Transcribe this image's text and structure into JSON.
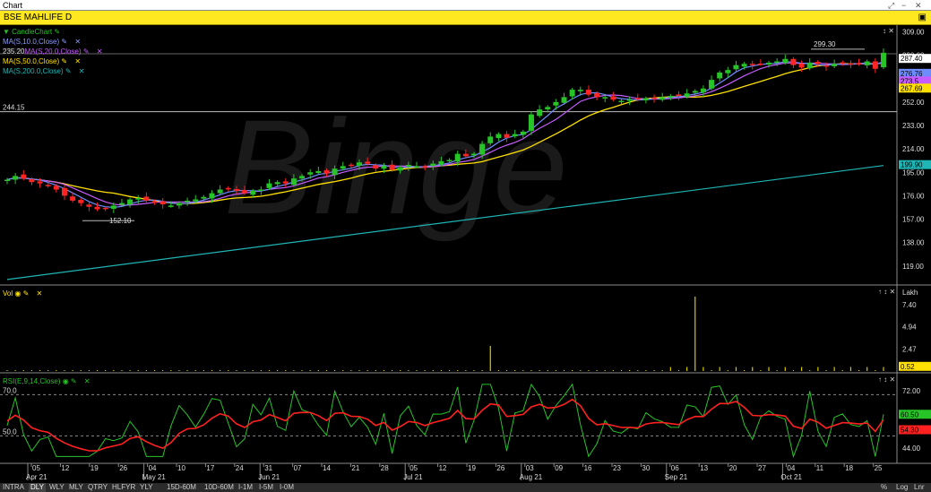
{
  "window": {
    "title": "Chart"
  },
  "symbol": {
    "label": "BSE MAHLIFE D"
  },
  "overlays": [
    {
      "label": "CandleChart",
      "color": "#27c427"
    },
    {
      "label": "MA(S,10.0,Close)",
      "color": "#6f8cff"
    },
    {
      "label": "MA(S,20.0,Close)",
      "color": "#c65cff",
      "prefix": "235.20"
    },
    {
      "label": "MA(S,50.0,Close)",
      "color": "#ffe000"
    },
    {
      "label": "MA(S,200.0,Close)",
      "color": "#1fb5b5"
    }
  ],
  "panels": {
    "vol": {
      "label": "Vol",
      "unit": "Lakh"
    },
    "rsi": {
      "label": "RSI(E,9,14,Close)"
    }
  },
  "bottom": {
    "intervals": [
      "INTRA",
      "DLY",
      "WLY",
      "MLY",
      "QTRY",
      "HLFYR",
      "YLY",
      "15D-60M",
      "10D-60M",
      "I-1M",
      "I-5M",
      "I-0M"
    ],
    "selected": "DLY",
    "right": [
      "%",
      "Log",
      "Lnr"
    ]
  },
  "chart_data": [
    {
      "type": "candlestick",
      "x_axis": {
        "ticks": [
          "05",
          "12",
          "19",
          "26",
          "04",
          "10",
          "17",
          "24",
          "31",
          "07",
          "14",
          "21",
          "28",
          "05",
          "12",
          "19",
          "26",
          "03",
          "09",
          "16",
          "23",
          "30",
          "06",
          "13",
          "20",
          "27",
          "04",
          "11",
          "18",
          "25"
        ],
        "months": [
          "Apr 21",
          "May 21",
          "Jun 21",
          "Jul 21",
          "Aug 21",
          "Sep 21",
          "Oct 21"
        ]
      },
      "y_ticks": [
        309.0,
        290.0,
        271.0,
        252.0,
        233.0,
        214.0,
        195.0,
        176.0,
        157.0,
        138.0,
        119.0
      ],
      "ylim": [
        105,
        313
      ],
      "grid": false,
      "close": [
        189,
        192,
        190,
        187,
        186,
        184,
        181,
        176,
        172,
        170,
        167,
        165,
        166,
        168,
        170,
        173,
        174,
        172,
        171,
        169,
        168,
        170,
        172,
        173,
        175,
        178,
        181,
        182,
        180,
        178,
        180,
        181,
        186,
        187,
        186,
        190,
        192,
        195,
        196,
        194,
        198,
        200,
        201,
        203,
        202,
        198,
        200,
        197,
        199,
        201,
        200,
        199,
        202,
        204,
        205,
        210,
        208,
        210,
        218,
        224,
        226,
        223,
        226,
        228,
        242,
        246,
        248,
        252,
        256,
        262,
        262,
        258,
        256,
        256,
        254,
        253,
        254,
        254,
        255,
        255,
        256,
        257,
        257,
        259,
        261,
        263,
        270,
        276,
        278,
        282,
        283,
        282,
        283,
        284,
        285,
        287,
        282,
        280,
        284,
        283,
        281,
        283,
        284,
        283,
        283,
        285,
        279,
        292
      ],
      "annotations": [
        {
          "text": "299.30",
          "value": 299.3
        },
        {
          "text": "244.15",
          "value": 244.15
        },
        {
          "text": "152.10",
          "value": 152.1
        }
      ],
      "series": [
        {
          "name": "MA(S,10.0,Close)",
          "last": 276.76,
          "last_label": "276.76"
        },
        {
          "name": "MA(S,20.0,Close)",
          "last": 273.5,
          "last_label": "273.5"
        },
        {
          "name": "MA(S,50.0,Close)",
          "last": 267.69,
          "last_label": "267.69"
        },
        {
          "name": "MA(S,200.0,Close)",
          "start": 108,
          "end": 200.5,
          "last_label": "199.90"
        }
      ],
      "last_price": {
        "value": 287.4,
        "label": "287.40"
      }
    },
    {
      "type": "bar",
      "title": "Vol",
      "unit": "Lakh",
      "y_ticks": [
        7.4,
        4.94,
        2.47
      ],
      "ylim": [
        0,
        9
      ],
      "values": [
        0.1,
        0.1,
        0.1,
        0.1,
        0.1,
        0.1,
        0.1,
        0.1,
        0.1,
        0.1,
        0.1,
        0.1,
        0.1,
        0.1,
        0.1,
        0.1,
        0.1,
        0.1,
        0.1,
        0.1,
        0.1,
        0.1,
        0.1,
        0.1,
        0.1,
        0.1,
        0.1,
        0.1,
        0.1,
        0.1,
        0.1,
        0.1,
        0.1,
        0.1,
        0.1,
        0.1,
        0.1,
        0.1,
        0.1,
        0.1,
        0.1,
        0.1,
        0.1,
        0.1,
        0.1,
        0.1,
        0.1,
        0.1,
        0.1,
        0.1,
        0.1,
        0.1,
        0.1,
        0.1,
        0.1,
        0.1,
        0.1,
        0.1,
        0.1,
        0.1,
        0.1,
        0.1,
        0.1,
        0.1,
        0.1,
        0.1,
        0.1,
        0.1,
        0.1,
        0.1,
        0.1,
        0.1,
        0.1,
        0.1,
        0.1,
        0.1,
        0.1,
        0.1,
        0.1,
        0.1,
        0.1,
        0.1,
        0.1,
        0.1,
        0.1,
        0.1,
        0.1,
        0.1,
        0.1,
        0.1,
        0.1,
        0.1,
        0.1,
        0.1,
        0.1,
        0.1,
        0.1,
        0.1,
        0.1,
        0.1,
        0.1,
        0.1,
        0.1,
        0.1,
        0.1,
        0.1,
        0.1,
        0.52
      ],
      "spikes": [
        {
          "index": 59,
          "value": 2.8
        },
        {
          "index": 84,
          "value": 8.3
        }
      ],
      "last": {
        "value": 0.52,
        "label": "0.52"
      }
    },
    {
      "type": "line",
      "title": "RSI(E,9,14,Close)",
      "y_ticks": [
        72.0,
        44.0
      ],
      "levels": [
        {
          "value": 70,
          "label": "70.0"
        },
        {
          "value": 50,
          "label": "50.0"
        }
      ],
      "ylim": [
        38,
        78
      ],
      "series": [
        {
          "name": "RSI",
          "color": "#27c427",
          "last": 60.5,
          "last_label": "60.50"
        },
        {
          "name": "Signal",
          "color": "#ff2020",
          "last": 54.3,
          "last_label": "54.30"
        }
      ]
    }
  ]
}
